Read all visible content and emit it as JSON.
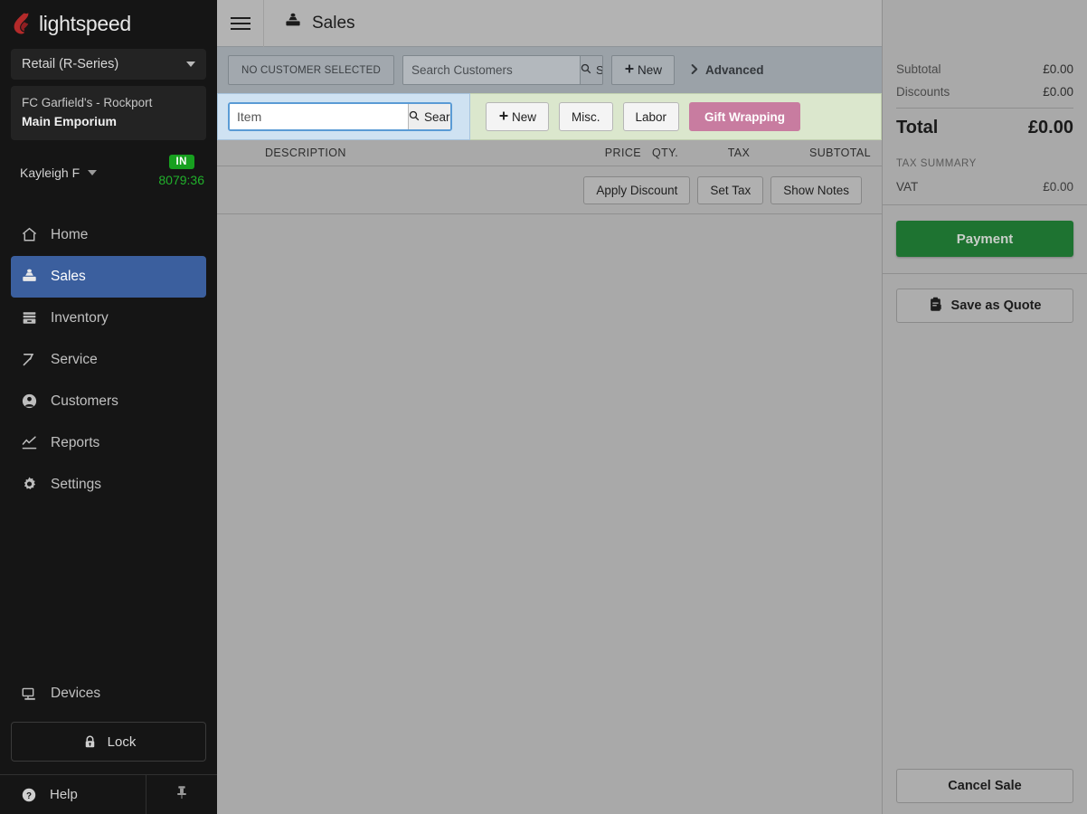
{
  "brand": {
    "name": "lightspeed",
    "flame_color": "#b32a2a"
  },
  "sidebar": {
    "account_select": {
      "label": "Retail (R-Series)",
      "caret": "chevron-down-icon"
    },
    "store": {
      "line1": "FC Garfield's - Rockport",
      "line2": "Main Emporium"
    },
    "user": {
      "name": "Kayleigh F",
      "status_badge": "IN",
      "clock": "8079:36",
      "badge_color": "#17a01f",
      "clock_color": "#21b02b"
    },
    "nav": [
      {
        "label": "Home",
        "icon": "home-icon",
        "active": false
      },
      {
        "label": "Sales",
        "icon": "sales-register-icon",
        "active": true
      },
      {
        "label": "Inventory",
        "icon": "inventory-box-icon",
        "active": false
      },
      {
        "label": "Service",
        "icon": "hammer-icon",
        "active": false
      },
      {
        "label": "Customers",
        "icon": "person-circle-icon",
        "active": false
      },
      {
        "label": "Reports",
        "icon": "line-chart-icon",
        "active": false
      },
      {
        "label": "Settings",
        "icon": "gear-icon",
        "active": false
      }
    ],
    "devices": {
      "label": "Devices",
      "icon": "monitor-icon"
    },
    "lock": {
      "label": "Lock",
      "icon": "lock-icon"
    },
    "help": {
      "label": "Help",
      "icon": "question-circle-icon"
    },
    "pin": {
      "icon": "pin-icon"
    },
    "active_color": "#3b5f9e"
  },
  "topbar": {
    "menu_icon": "hamburger-icon",
    "page_icon": "sales-register-icon",
    "title": "Sales"
  },
  "customer_bar": {
    "no_customer_label": "NO CUSTOMER SELECTED",
    "search_placeholder": "Search Customers",
    "search_value": "",
    "search_button": "Search",
    "search_icon": "search-icon",
    "new_button": "New",
    "new_icon": "plus-icon",
    "advanced_label": "Advanced",
    "advanced_icon": "chevron-right-icon"
  },
  "item_bar": {
    "item_placeholder": "Item",
    "item_value": "",
    "search_button": "Search",
    "search_icon": "search-icon",
    "buttons": [
      {
        "label": "New",
        "icon": "plus-icon",
        "style": "default"
      },
      {
        "label": "Misc.",
        "icon": "",
        "style": "default"
      },
      {
        "label": "Labor",
        "icon": "",
        "style": "default"
      },
      {
        "label": "Gift Wrapping",
        "icon": "",
        "style": "gift"
      }
    ],
    "gift_color": "#c87ca0"
  },
  "cart": {
    "columns": [
      "DESCRIPTION",
      "PRICE",
      "QTY.",
      "TAX",
      "SUBTOTAL"
    ],
    "rows": [],
    "line_actions": [
      "Apply Discount",
      "Set Tax",
      "Show Notes"
    ]
  },
  "right_panel": {
    "totals": [
      {
        "label": "Subtotal",
        "value": "£0.00"
      },
      {
        "label": "Discounts",
        "value": "£0.00"
      }
    ],
    "total": {
      "label": "Total",
      "value": "£0.00"
    },
    "tax_summary_heading": "TAX SUMMARY",
    "taxes": [
      {
        "label": "VAT",
        "value": "£0.00"
      }
    ],
    "payment_button": "Payment",
    "payment_color": "#1e7331",
    "quote_button": "Save as Quote",
    "quote_icon": "clipboard-icon",
    "cancel_button": "Cancel Sale"
  }
}
